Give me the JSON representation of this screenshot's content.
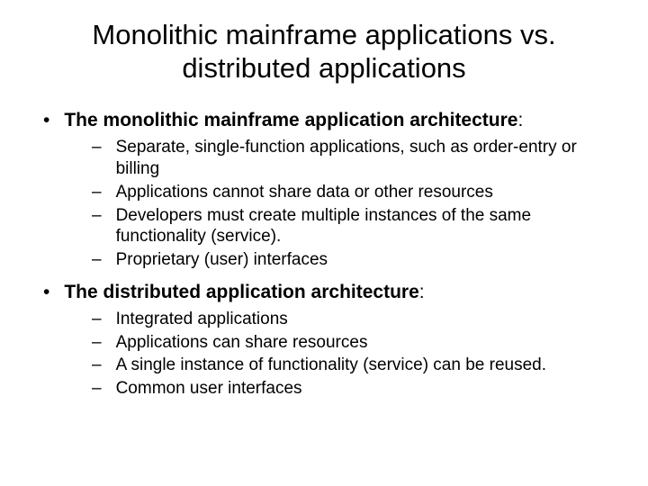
{
  "title": "Monolithic mainframe applications vs. distributed applications",
  "sections": [
    {
      "header": "The monolithic mainframe application architecture",
      "items": [
        "Separate, single-function applications, such as order-entry or billing",
        "Applications cannot share data or other resources",
        "Developers must create multiple instances of the same functionality (service).",
        "Proprietary (user) interfaces"
      ]
    },
    {
      "header": "The distributed application architecture",
      "items": [
        "Integrated applications",
        "Applications can share resources",
        "A single instance of functionality (service) can be reused.",
        "Common user interfaces"
      ]
    }
  ],
  "bullet": "•",
  "dash": "–",
  "colon": ":"
}
